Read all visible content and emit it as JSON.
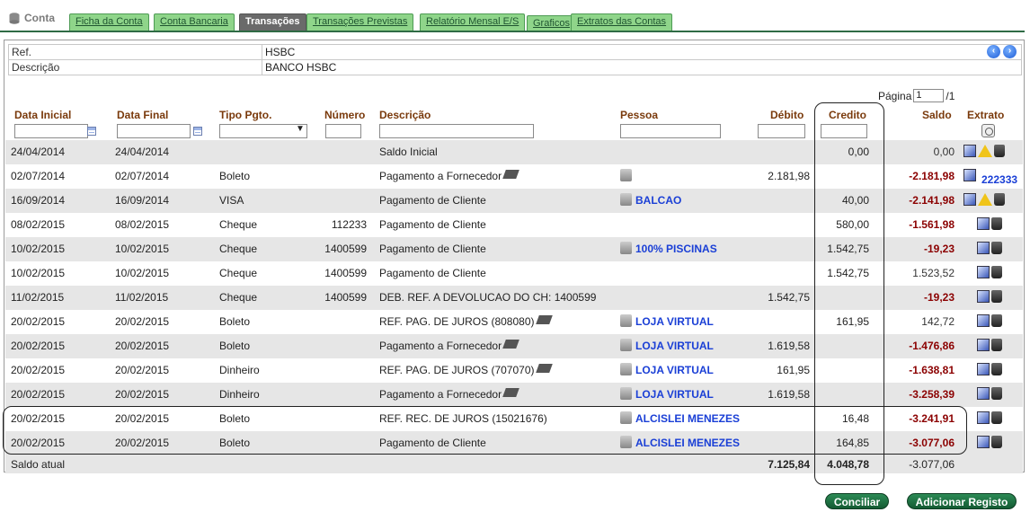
{
  "tabs": {
    "brand": "Conta",
    "items": [
      "Ficha da Conta",
      "Conta Bancaria",
      "Transações",
      "Transações Previstas",
      "Relatório Mensal E/S",
      "Graficos",
      "Extratos das Contas"
    ],
    "active": "Transações"
  },
  "info": {
    "ref_label": "Ref.",
    "ref_value": "HSBC",
    "desc_label": "Descrição",
    "desc_value": "BANCO HSBC"
  },
  "pager": {
    "label": "Página",
    "current": "1",
    "total": "/1"
  },
  "columns": {
    "data_inicial": "Data Inicial",
    "data_final": "Data Final",
    "tipo_pgto": "Tipo Pgto.",
    "numero": "Número",
    "descricao": "Descrição",
    "pessoa": "Pessoa",
    "debito": "Débito",
    "credito": "Credito",
    "saldo": "Saldo",
    "extrato": "Extrato"
  },
  "rows": [
    {
      "d1": "24/04/2014",
      "d2": "24/04/2014",
      "tipo": "",
      "num": "",
      "desc": "Saldo Inicial",
      "pessoa": "",
      "deb": "",
      "cred": "0,00",
      "saldo": "0,00",
      "neg": false,
      "extrato": ""
    },
    {
      "d1": "02/07/2014",
      "d2": "02/07/2014",
      "tipo": "Boleto",
      "num": "",
      "desc": "Pagamento a Fornecedor",
      "pessoa": "",
      "deb": "2.181,98",
      "cred": "",
      "saldo": "-2.181,98",
      "neg": true,
      "extrato": "222333"
    },
    {
      "d1": "16/09/2014",
      "d2": "16/09/2014",
      "tipo": "VISA",
      "num": "",
      "desc": "Pagamento de Cliente",
      "pessoa": "BALCAO",
      "deb": "",
      "cred": "40,00",
      "saldo": "-2.141,98",
      "neg": true,
      "extrato": ""
    },
    {
      "d1": "08/02/2015",
      "d2": "08/02/2015",
      "tipo": "Cheque",
      "num": "112233",
      "desc": "Pagamento de Cliente",
      "pessoa": "",
      "deb": "",
      "cred": "580,00",
      "saldo": "-1.561,98",
      "neg": true,
      "extrato": ""
    },
    {
      "d1": "10/02/2015",
      "d2": "10/02/2015",
      "tipo": "Cheque",
      "num": "1400599",
      "desc": "Pagamento de Cliente",
      "pessoa": "100% PISCINAS",
      "deb": "",
      "cred": "1.542,75",
      "saldo": "-19,23",
      "neg": true,
      "extrato": ""
    },
    {
      "d1": "10/02/2015",
      "d2": "10/02/2015",
      "tipo": "Cheque",
      "num": "1400599",
      "desc": "Pagamento de Cliente",
      "pessoa": "",
      "deb": "",
      "cred": "1.542,75",
      "saldo": "1.523,52",
      "neg": false,
      "extrato": ""
    },
    {
      "d1": "11/02/2015",
      "d2": "11/02/2015",
      "tipo": "Cheque",
      "num": "1400599",
      "desc": "DEB. REF. A DEVOLUCAO DO CH: 1400599",
      "pessoa": "",
      "deb": "1.542,75",
      "cred": "",
      "saldo": "-19,23",
      "neg": true,
      "extrato": ""
    },
    {
      "d1": "20/02/2015",
      "d2": "20/02/2015",
      "tipo": "Boleto",
      "num": "",
      "desc": "REF. PAG. DE JUROS (808080)",
      "pessoa": "LOJA VIRTUAL",
      "deb": "",
      "cred": "161,95",
      "saldo": "142,72",
      "neg": false,
      "extrato": ""
    },
    {
      "d1": "20/02/2015",
      "d2": "20/02/2015",
      "tipo": "Boleto",
      "num": "",
      "desc": "Pagamento a Fornecedor",
      "pessoa": "LOJA VIRTUAL",
      "deb": "1.619,58",
      "cred": "",
      "saldo": "-1.476,86",
      "neg": true,
      "extrato": ""
    },
    {
      "d1": "20/02/2015",
      "d2": "20/02/2015",
      "tipo": "Dinheiro",
      "num": "",
      "desc": "REF. PAG. DE JUROS (707070)",
      "pessoa": "LOJA VIRTUAL",
      "deb": "161,95",
      "cred": "",
      "saldo": "-1.638,81",
      "neg": true,
      "extrato": ""
    },
    {
      "d1": "20/02/2015",
      "d2": "20/02/2015",
      "tipo": "Dinheiro",
      "num": "",
      "desc": "Pagamento a Fornecedor",
      "pessoa": "LOJA VIRTUAL",
      "deb": "1.619,58",
      "cred": "",
      "saldo": "-3.258,39",
      "neg": true,
      "extrato": ""
    },
    {
      "d1": "20/02/2015",
      "d2": "20/02/2015",
      "tipo": "Boleto",
      "num": "",
      "desc": "REF. REC. DE JUROS (15021676)",
      "pessoa": "ALCISLEI MENEZES",
      "deb": "",
      "cred": "16,48",
      "saldo": "-3.241,91",
      "neg": true,
      "extrato": ""
    },
    {
      "d1": "20/02/2015",
      "d2": "20/02/2015",
      "tipo": "Boleto",
      "num": "",
      "desc": "Pagamento de Cliente",
      "pessoa": "ALCISLEI MENEZES",
      "deb": "",
      "cred": "164,85",
      "saldo": "-3.077,06",
      "neg": true,
      "extrato": ""
    }
  ],
  "totals": {
    "label": "Saldo atual",
    "debito": "7.125,84",
    "credito": "4.048,78",
    "saldo": "-3.077,06"
  },
  "buttons": {
    "conciliar": "Conciliar",
    "adicionar": "Adicionar Registo"
  }
}
